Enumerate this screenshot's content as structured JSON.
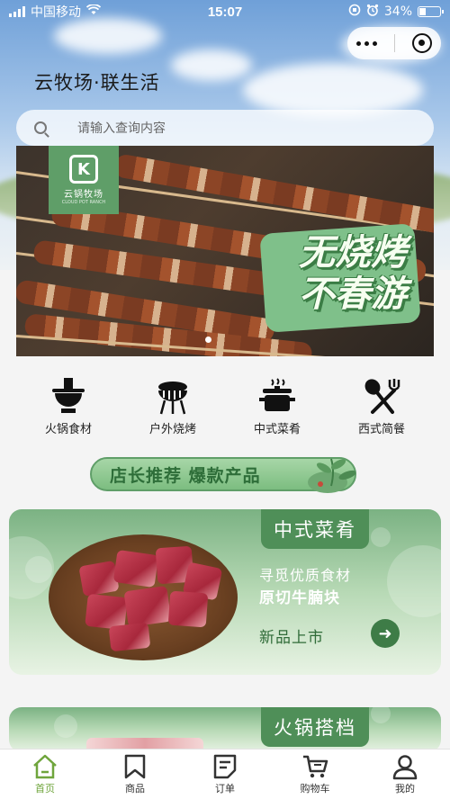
{
  "status_bar": {
    "carrier": "中国移动",
    "time": "15:07",
    "battery": "34%",
    "battery_level": 0.34
  },
  "app": {
    "title": "云牧场·联生活"
  },
  "search": {
    "placeholder": "请输入查询内容"
  },
  "banner": {
    "logo_text": "云锅牧场",
    "logo_sub": "CLOUD POT RANCH",
    "slogan_line1": "无烧烤",
    "slogan_line2": "不春游",
    "slides": 2,
    "active_slide": 2
  },
  "categories": [
    {
      "label": "火锅食材",
      "icon": "hotpot-icon"
    },
    {
      "label": "户外烧烤",
      "icon": "grill-icon"
    },
    {
      "label": "中式菜肴",
      "icon": "cooking-pot-icon"
    },
    {
      "label": "西式简餐",
      "icon": "fork-spatula-icon"
    }
  ],
  "recommend": {
    "label": "店长推荐  爆款产品"
  },
  "cards": [
    {
      "tab": "中式菜肴",
      "subtitle": "寻觅优质食材",
      "product": "原切牛腩块",
      "cta": "新品上市"
    },
    {
      "tab": "火锅搭档"
    }
  ],
  "tabbar": [
    {
      "label": "首页",
      "icon": "home-icon",
      "active": true
    },
    {
      "label": "商品",
      "icon": "bookmark-icon",
      "active": false
    },
    {
      "label": "订单",
      "icon": "order-icon",
      "active": false
    },
    {
      "label": "购物车",
      "icon": "cart-icon",
      "active": false
    },
    {
      "label": "我的",
      "icon": "user-icon",
      "active": false
    }
  ],
  "colors": {
    "brand_green": "#5f9e68",
    "active_tab": "#6fa53c"
  }
}
